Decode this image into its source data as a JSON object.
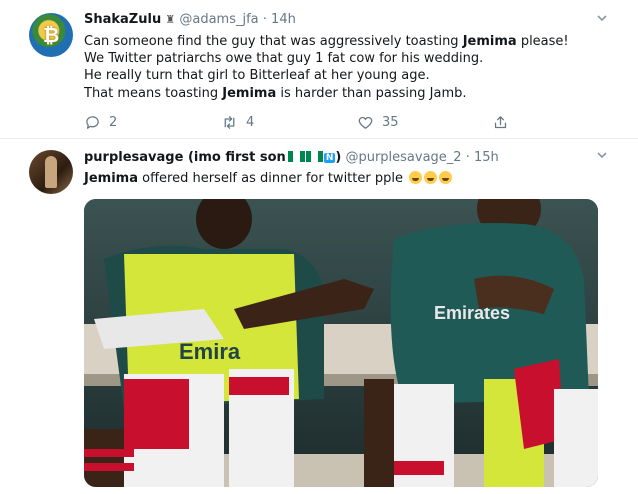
{
  "tweets": [
    {
      "name": "ShakaZulu",
      "handle": "@adams_jfa",
      "time": "· 14h",
      "lines": [
        {
          "pre": "Can someone find the guy that was aggressively toasting ",
          "bold": "Jemima",
          "post": " please!"
        },
        {
          "pre": "We Twitter patriarchs owe that guy 1 fat cow for his wedding.",
          "bold": "",
          "post": ""
        },
        {
          "pre": "He really turn that girl to Bitterleaf at her young age.",
          "bold": "",
          "post": ""
        },
        {
          "pre": "That means toasting ",
          "bold": "Jemima",
          "post": " is harder than passing Jamb."
        }
      ],
      "replies": "2",
      "retweets": "4",
      "likes": "35"
    },
    {
      "name": "purplesavage (imo first son",
      "name_suffix": ")",
      "badge": "N",
      "handle": "@purplesavage_2",
      "time": "· 15h",
      "text_bold": "Jemima",
      "text_rest": " offered herself as dinner for twitter pple",
      "emojis": [
        "grinning-face",
        "grinning-face",
        "grinning-face"
      ]
    }
  ],
  "colors": {
    "text": "#14171a",
    "secondary": "#657786",
    "border": "#e6ecf0",
    "flag_green": "#008751",
    "badge_blue": "#1da1f2"
  }
}
